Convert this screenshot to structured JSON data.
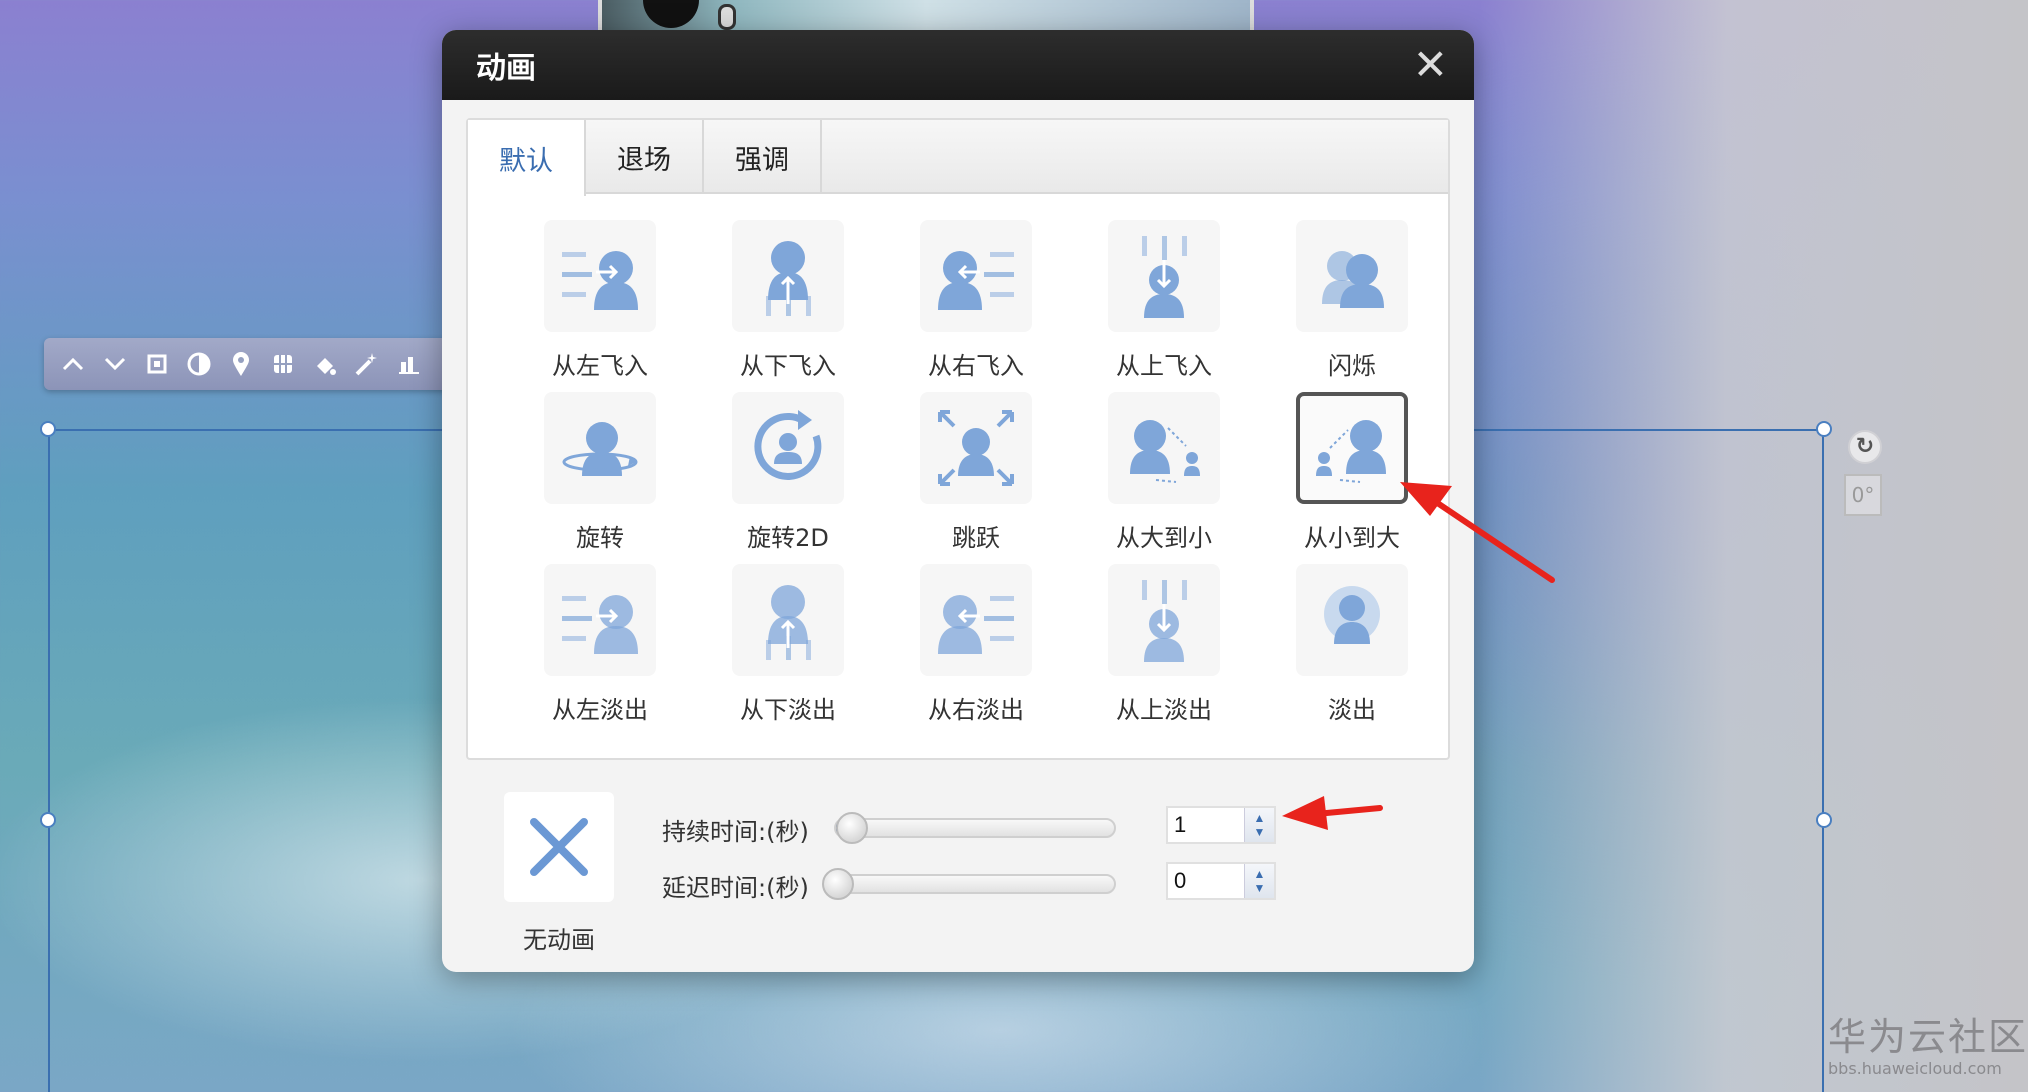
{
  "dialog": {
    "title": "动画",
    "close_label": "✕",
    "tabs": [
      {
        "label": "默认",
        "active": true
      },
      {
        "label": "退场",
        "active": false
      },
      {
        "label": "强调",
        "active": false
      }
    ],
    "animations": [
      {
        "label": "从左飞入",
        "icon": "fly-in-left-icon"
      },
      {
        "label": "从下飞入",
        "icon": "fly-in-bottom-icon"
      },
      {
        "label": "从右飞入",
        "icon": "fly-in-right-icon"
      },
      {
        "label": "从上飞入",
        "icon": "fly-in-top-icon"
      },
      {
        "label": "闪烁",
        "icon": "flash-icon"
      },
      {
        "label": "旋转",
        "icon": "rotate-icon"
      },
      {
        "label": "旋转2D",
        "icon": "rotate-2d-icon"
      },
      {
        "label": "跳跃",
        "icon": "jump-icon"
      },
      {
        "label": "从大到小",
        "icon": "zoom-out-icon"
      },
      {
        "label": "从小到大",
        "icon": "zoom-in-icon",
        "selected": true
      },
      {
        "label": "从左淡出",
        "icon": "fade-out-left-icon"
      },
      {
        "label": "从下淡出",
        "icon": "fade-out-bottom-icon"
      },
      {
        "label": "从右淡出",
        "icon": "fade-out-right-icon"
      },
      {
        "label": "从上淡出",
        "icon": "fade-out-top-icon"
      },
      {
        "label": "淡出",
        "icon": "fade-out-icon"
      }
    ],
    "no_animation_label": "无动画",
    "duration": {
      "label": "持续时间:(秒)",
      "value": "1",
      "slider_fraction": 0.05
    },
    "delay": {
      "label": "延迟时间:(秒)",
      "value": "0",
      "slider_fraction": 0.0
    }
  },
  "canvas": {
    "rotation_angle": "0°"
  },
  "watermark": {
    "name": "华为云社区",
    "url": "bbs.huaweicloud.com"
  },
  "colors": {
    "accent": "#3a6db0",
    "icon_blue": "#7fa6d9",
    "header_dark": "#1e1e1e",
    "arrow_red": "#e8231c"
  }
}
